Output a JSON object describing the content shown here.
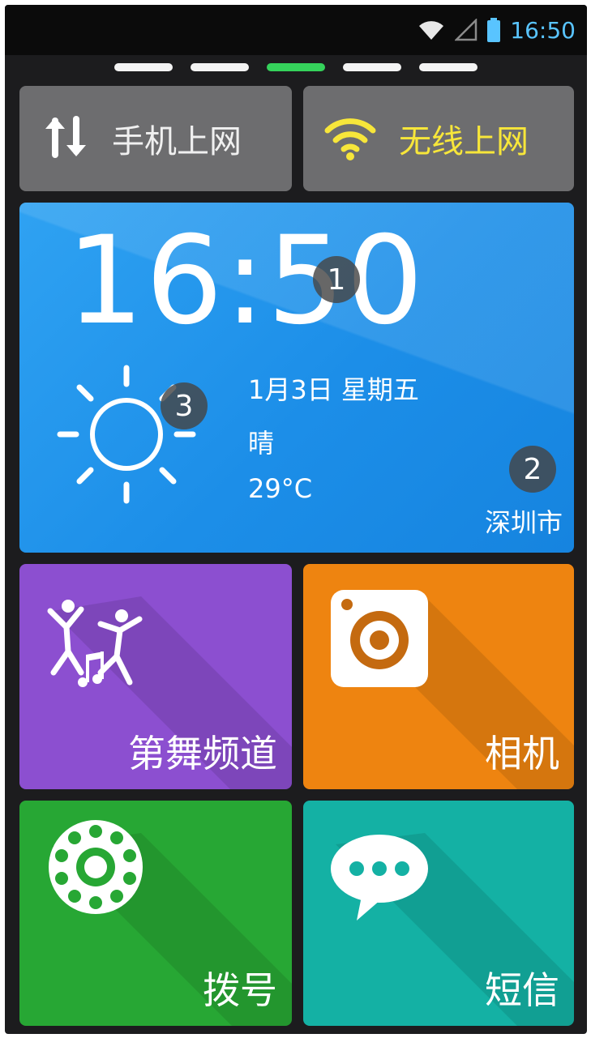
{
  "status_bar": {
    "time": "16:50",
    "icons": [
      "wifi-icon",
      "cellular-signal-icon",
      "battery-icon"
    ],
    "time_color": "#59c4ff"
  },
  "pager": {
    "page_count": 5,
    "active_index": 2,
    "active_color": "#35d25b"
  },
  "toggles": {
    "mobile_data": {
      "label": "手机上网",
      "icon": "data-transfer-icon"
    },
    "wifi": {
      "label": "无线上网",
      "icon": "wifi-icon",
      "active_color": "#f7e63a"
    }
  },
  "clock_widget": {
    "time": "16:50",
    "date": "1月3日  星期五",
    "condition": "晴",
    "temperature": "29°C",
    "city": "深圳市",
    "weather_icon": "sun-icon",
    "color": "#1c8ee8",
    "badges": [
      "1",
      "2",
      "3"
    ]
  },
  "apps": [
    {
      "label": "第舞频道",
      "icon": "dancers-icon",
      "color": "#8c4fd0"
    },
    {
      "label": "相机",
      "icon": "camera-icon",
      "color": "#ee8410"
    },
    {
      "label": "拨号",
      "icon": "rotary-dial-icon",
      "color": "#27a734"
    },
    {
      "label": "短信",
      "icon": "chat-bubble-icon",
      "color": "#14b1a4"
    }
  ]
}
